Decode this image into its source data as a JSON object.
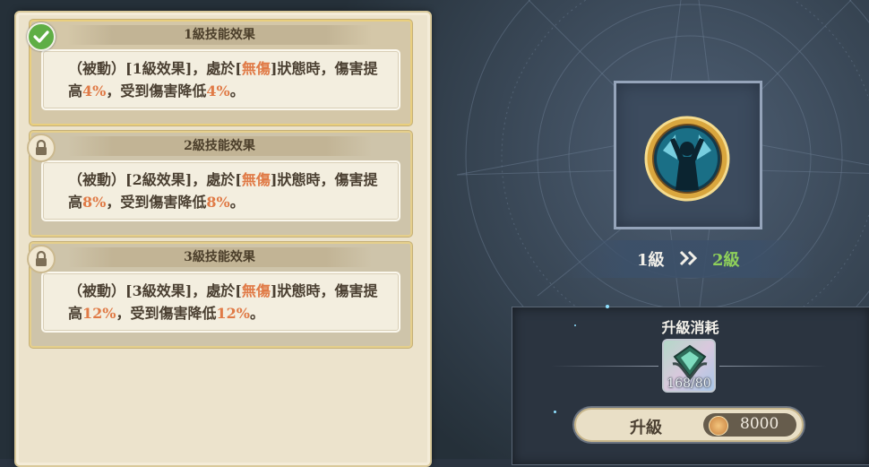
{
  "skill_levels": [
    {
      "title": "1級技能效果",
      "state": "unlocked",
      "state_icon": "check-icon",
      "desc_prefix": "（被動）[1級效果]，處於[",
      "desc_status": "無傷",
      "desc_mid": "]狀態時，傷害提高",
      "desc_bonus1": "4%",
      "desc_mid2": "，受到傷害降低",
      "desc_bonus2": "4%",
      "desc_end": "。"
    },
    {
      "title": "2級技能效果",
      "state": "locked",
      "state_icon": "lock-icon",
      "desc_prefix": "（被動）[2級效果]，處於[",
      "desc_status": "無傷",
      "desc_mid": "]狀態時，傷害提高",
      "desc_bonus1": "8%",
      "desc_mid2": "，受到傷害降低",
      "desc_bonus2": "8%",
      "desc_end": "。"
    },
    {
      "title": "3級技能效果",
      "state": "locked",
      "state_icon": "lock-icon",
      "desc_prefix": "（被動）[3級效果]，處於[",
      "desc_status": "無傷",
      "desc_mid": "]狀態時，傷害提高",
      "desc_bonus1": "12%",
      "desc_mid2": "，受到傷害降低",
      "desc_bonus2": "12%",
      "desc_end": "。"
    }
  ],
  "level_change": {
    "from": "1級",
    "arrow_icon": "double-chevron-right-icon",
    "to": "2級"
  },
  "upgrade_cost": {
    "title": "升級消耗",
    "item_count": "168/80",
    "button_label": "升級",
    "coin_icon": "coin-icon",
    "coin_cost": "8000"
  },
  "colors": {
    "highlight": "#e07a46",
    "level_to": "#8fd05a",
    "level_from": "#f1efe8"
  }
}
